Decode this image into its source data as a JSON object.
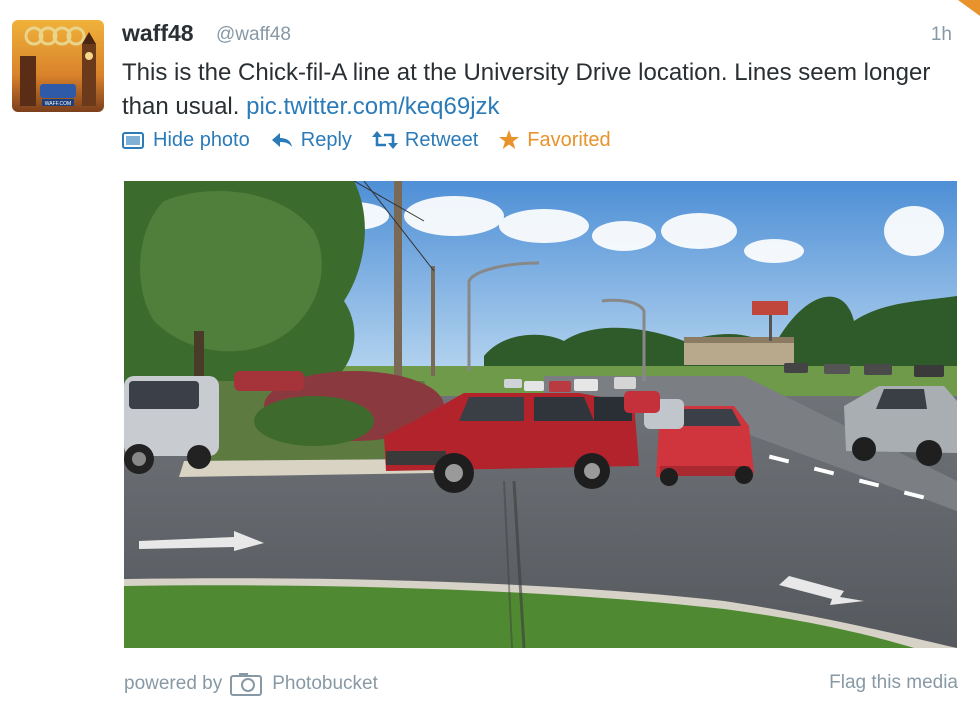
{
  "tweet": {
    "name": "waff48",
    "handle": "@waff48",
    "time": "1h",
    "text": "This is the Chick-fil-A line at the University Drive location. Lines seem longer than usual.",
    "link": "pic.twitter.com/keq69jzk",
    "avatar_label": "WAFF.COM"
  },
  "actions": {
    "hide_photo": "Hide photo",
    "reply": "Reply",
    "retweet": "Retweet",
    "favorited": "Favorited"
  },
  "footer": {
    "powered_by": "powered by",
    "provider": "Photobucket",
    "flag": "Flag this media"
  },
  "colors": {
    "link": "#2b7bb9",
    "favorited": "#e8932b",
    "muted": "#8899a6"
  },
  "icons": [
    "photo-icon",
    "reply-arrow-icon",
    "retweet-icon",
    "star-icon",
    "camera-icon"
  ]
}
